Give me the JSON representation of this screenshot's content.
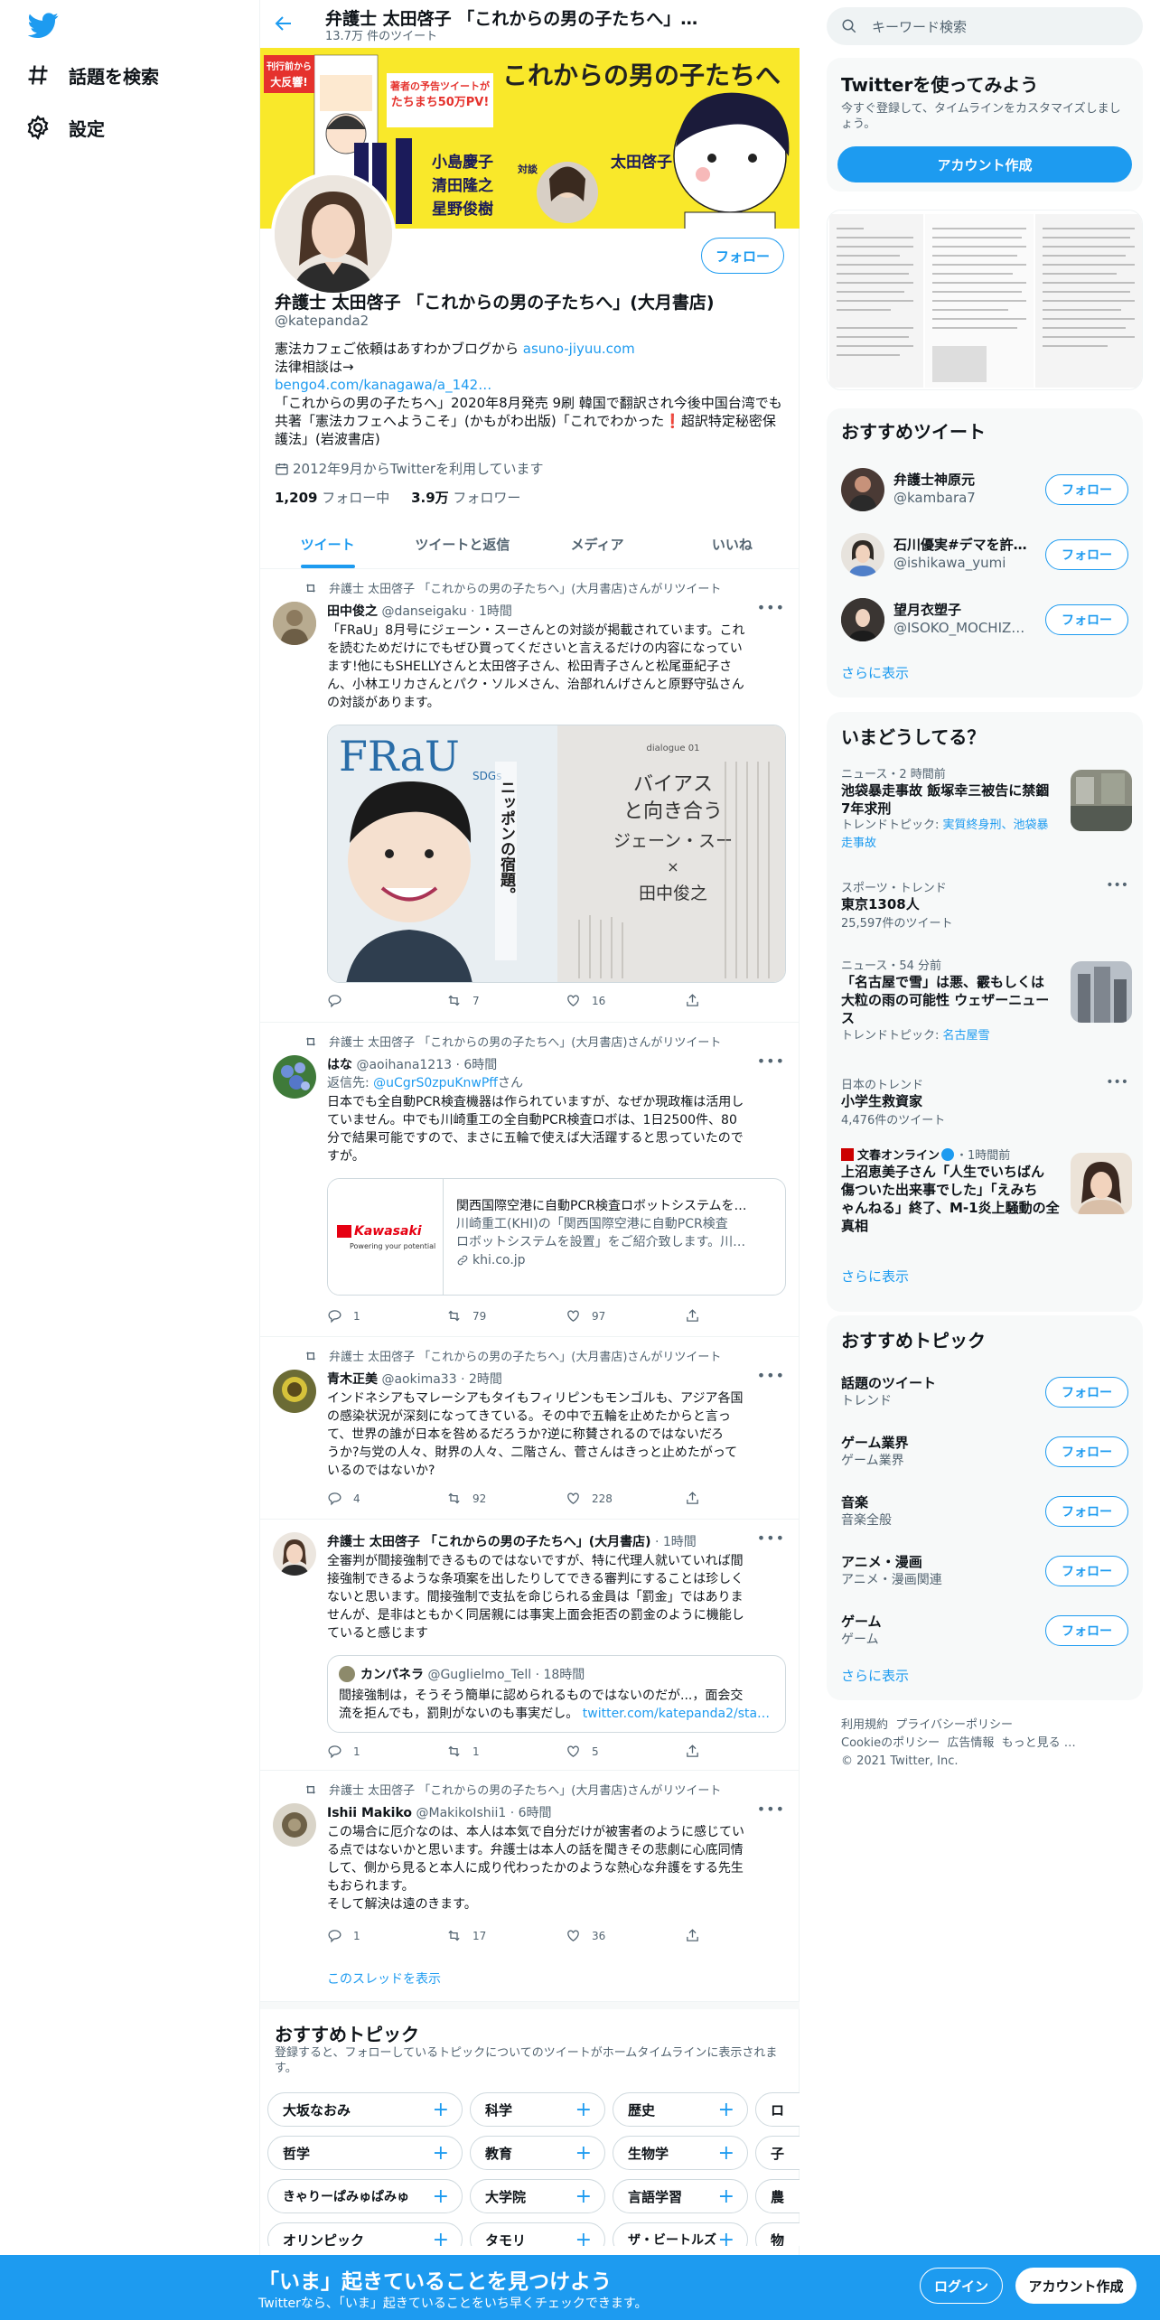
{
  "nav": {
    "explore_label": "話題を検索",
    "settings_label": "設定"
  },
  "header": {
    "name": "弁護士 太田啓子 「これからの男の子たちへ」…",
    "tweet_count": "13.7万 件のツイート"
  },
  "banner": {
    "badge_line1": "刊行前から",
    "badge_line2": "大反響!",
    "book_title": "これからの男の子たちへ",
    "headline_line1": "著者の予告ツイートが",
    "headline_line2": "たちまち50万PV!",
    "talk_label": "対談",
    "name1": "小島慶子",
    "name2": "清田隆之",
    "name3": "星野俊樹",
    "author": "太田啓子"
  },
  "profile": {
    "name": "弁護士 太田啓子 「これからの男の子たちへ」(大月書店)",
    "handle": "@katepanda2",
    "follow_label": "フォロー",
    "bio_line1": "憲法カフェご依頼はあすわかブログから",
    "bio_link1": "asuno-jiyuu.com",
    "bio_line2": "法律相談は→",
    "bio_link2": "bengo4.com/kanagawa/a_142…",
    "bio_line3": "「これからの男の子たちへ」2020年8月発売 9刷 韓国で翻訳され今後中国台湾でも",
    "bio_line4": "共著「憲法カフェへようこそ」(かもがわ出版)「これでわかった❗️超訳特定秘密保",
    "bio_line5": "護法」(岩波書店)",
    "joined": "2012年9月からTwitterを利用しています",
    "following_count": "1,209",
    "following_label": " フォロー中",
    "followers_count": "3.9万",
    "followers_label": " フォロワー"
  },
  "tabs": [
    "ツイート",
    "ツイートと返信",
    "メディア",
    "いいね"
  ],
  "tweets": [
    {
      "retweeted_by": "弁護士 太田啓子 「これからの男の子たちへ」(大月書店)さんがリツイート",
      "name": "田中俊之",
      "meta": "@danseigaku · 1時間",
      "lines": [
        "「FRaU」8月号にジェーン・スーさんとの対談が掲載されています。これ",
        "を読むためだけにでもぜひ買ってくださいと言えるだけの内容になってい",
        "ます!他にもSHELLYさんと太田啓子さん、松田青子さんと松尾亜紀子さ",
        "ん、小林エリカさんとパク・ソルメさん、治部れんげさんと原野守弘さん",
        "の対談があります。"
      ],
      "img_text_left_brand": "FRaU",
      "img_text_left_tag": "SDGs",
      "img_text_left_vertical": "ニッポンの宿題。",
      "img_text_right_dialogue": "dialogue 01",
      "img_text_right_title1": "バイアス",
      "img_text_right_title2": "と向き合う",
      "img_text_right_name1": "ジェーン・スー",
      "img_text_right_x": "×",
      "img_text_right_name2": "田中俊之",
      "replies": "",
      "retweets": "7",
      "likes": "16"
    },
    {
      "retweeted_by": "弁護士 太田啓子 「これからの男の子たちへ」(大月書店)さんがリツイート",
      "name": "はな",
      "meta": "@aoihana1213 · 6時間",
      "reply_prefix": "返信先: ",
      "reply_to": "@uCgrS0zpuKnwPff",
      "reply_suffix": "さん",
      "lines": [
        "日本でも全自動PCR検査機器は作られていますが、なぜか現政権は活用し",
        "ていません。中でも川崎重工の全自動PCR検査ロボは、1日2500件、80",
        "分で結果可能ですので、まさに五輪で使えば大活躍すると思っていたので",
        "すが。"
      ],
      "card_logo": "Kawasaki",
      "card_logo_sub": "Powering your potential",
      "card_title": "関西国際空港に自動PCR検査ロボットシステムを…",
      "card_desc1": "川崎重工(KHI)の「関西国際空港に自動PCR検査",
      "card_desc2": "ロボットシステムを設置」をご紹介致します。川…",
      "card_domain": "khi.co.jp",
      "replies": "1",
      "retweets": "79",
      "likes": "97"
    },
    {
      "retweeted_by": "弁護士 太田啓子 「これからの男の子たちへ」(大月書店)さんがリツイート",
      "name": "青木正美",
      "meta": "@aokima33 · 2時間",
      "lines": [
        "インドネシアもマレーシアもタイもフィリピンもモンゴルも、アジア各国",
        "の感染状況が深刻になってきている。その中で五輪を止めたからと言っ",
        "て、世界の誰が日本を咎めるだろうか?逆に称賛されるのではないだろ",
        "うか?与党の人々、財界の人々、二階さん、菅さんはきっと止めたがって",
        "いるのではないか?"
      ],
      "replies": "4",
      "retweets": "92",
      "likes": "228"
    },
    {
      "name": "弁護士 太田啓子 「これからの男の子たちへ」(大月書店)",
      "meta": "· 1時間",
      "lines": [
        "全審判が間接強制できるものではないですが、特に代理人就いていれば間",
        "接強制できるような条項案を出したりしてできる審判にすることは珍しく",
        "ないと思います。間接強制で支払を命じられる金員は「罰金」ではありま",
        "せんが、是非はともかく同居親には事実上面会拒否の罰金のように機能し",
        "ていると感じます"
      ],
      "quote_name": "カンパネラ",
      "quote_meta": "@Guglielmo_Tell · 18時間",
      "quote_line1": "間接強制は，そうそう簡単に認められるものではないのだが...，面会交",
      "quote_line2": "流を拒んでも，罰則がないのも事実だし。",
      "quote_link": "twitter.com/katepanda2/sta…",
      "replies": "1",
      "retweets": "1",
      "likes": "5"
    },
    {
      "retweeted_by": "弁護士 太田啓子 「これからの男の子たちへ」(大月書店)さんがリツイート",
      "name": "Ishii Makiko",
      "meta": "@MakikoIshii1 · 6時間",
      "lines": [
        "この場合に厄介なのは、本人は本気で自分だけが被害者のように感じてい",
        "る点ではないかと思います。弁護士は本人の話を聞きその悲劇に心底同情",
        "して、側から見ると本人に成り代わったかのような熱心な弁護をする先生",
        "もおられます。",
        "そして解決は遠のきます。"
      ],
      "replies": "1",
      "retweets": "17",
      "likes": "36",
      "thread_link": "このスレッドを表示"
    }
  ],
  "topics_section": {
    "title": "おすすめトピック",
    "subtitle": "登録すると、フォローしているトピックについてのツイートがホームタイムラインに表示されま",
    "subtitle2": "す。",
    "rows": [
      [
        "大坂なおみ",
        "科学",
        "歴史",
        "ロ"
      ],
      [
        "哲学",
        "教育",
        "生物学",
        "子"
      ],
      [
        "きゃりーぱみゅぱみゅ",
        "大学院",
        "言語学習",
        "農"
      ],
      [
        "オリンピック",
        "タモリ",
        "ザ・ビートルズ",
        "物"
      ]
    ]
  },
  "right": {
    "search_placeholder": "キーワード検索",
    "signup_title": "Twitterを使ってみよう",
    "signup_desc1": "今すぐ登録して、タイムラインをカスタマイズしまし",
    "signup_desc2": "ょう。",
    "signup_button": "アカウント作成",
    "reco_title": "おすすめツイート",
    "reco_users": [
      {
        "name": "弁護士神原元",
        "handle": "@kambara7"
      },
      {
        "name": "石川優実#デマを許…",
        "handle": "@ishikawa_yumi"
      },
      {
        "name": "望月衣塑子",
        "handle": "@ISOKO_MOCHIZ…"
      }
    ],
    "follow_label": "フォロー",
    "show_more": "さらに表示",
    "trends_title": "いまどうしてる？",
    "trends": [
      {
        "meta": "ニュース・2 時間前",
        "title1": "池袋暴走事故 飯塚幸三被告に禁錮",
        "title2": "7年求刑",
        "extra_prefix": "トレンドトピック: ",
        "extra_link1": "実質終身刑、池袋暴",
        "extra_link2": "走事故"
      },
      {
        "meta": "スポーツ・トレンド",
        "title1": "東京1308人",
        "count": "25,597件のツイート"
      },
      {
        "meta": "ニュース・54 分前",
        "title1": "「名古屋で雪」は悪、霰もしくは",
        "title2": "大粒の雨の可能性 ウェザーニュー",
        "title3": "ス",
        "extra_prefix": "トレンドトピック: ",
        "extra_link1": "名古屋雪"
      },
      {
        "meta": "日本のトレンド",
        "title1": "小学生救資家",
        "count": "4,476件のツイート"
      },
      {
        "meta_name": "文春オンライン",
        "meta_time": "・1時間前",
        "title1": "上沼恵美子さん「人生でいちばん",
        "title2": "傷ついた出来事でした」「えみち",
        "title3": "ゃんねる」終了、M-1炎上騒動の全",
        "title4": "真相"
      }
    ],
    "topics_title": "おすすめトピック",
    "topics": [
      {
        "name": "話題のツイート",
        "cat": "トレンド"
      },
      {
        "name": "ゲーム業界",
        "cat": "ゲーム業界"
      },
      {
        "name": "音楽",
        "cat": "音楽全般"
      },
      {
        "name": "アニメ・漫画",
        "cat": "アニメ・漫画関連"
      },
      {
        "name": "ゲーム",
        "cat": "ゲーム"
      }
    ],
    "footer": [
      "利用規約",
      "プライバシーポリシー",
      "Cookieのポリシー",
      "広告情報",
      "もっと見る …",
      "© 2021 Twitter, Inc."
    ]
  },
  "bottom": {
    "title": "「いま」起きていることを見つけよう",
    "subtitle": "Twitterなら、「いま」起きていることをいち早くチェックできます。",
    "login": "ログイン",
    "signup": "アカウント作成"
  },
  "colors": {
    "accent": "#1d9bf0",
    "banner_yellow": "#f9e82a",
    "bottom_bar": "#1d9bf0"
  }
}
